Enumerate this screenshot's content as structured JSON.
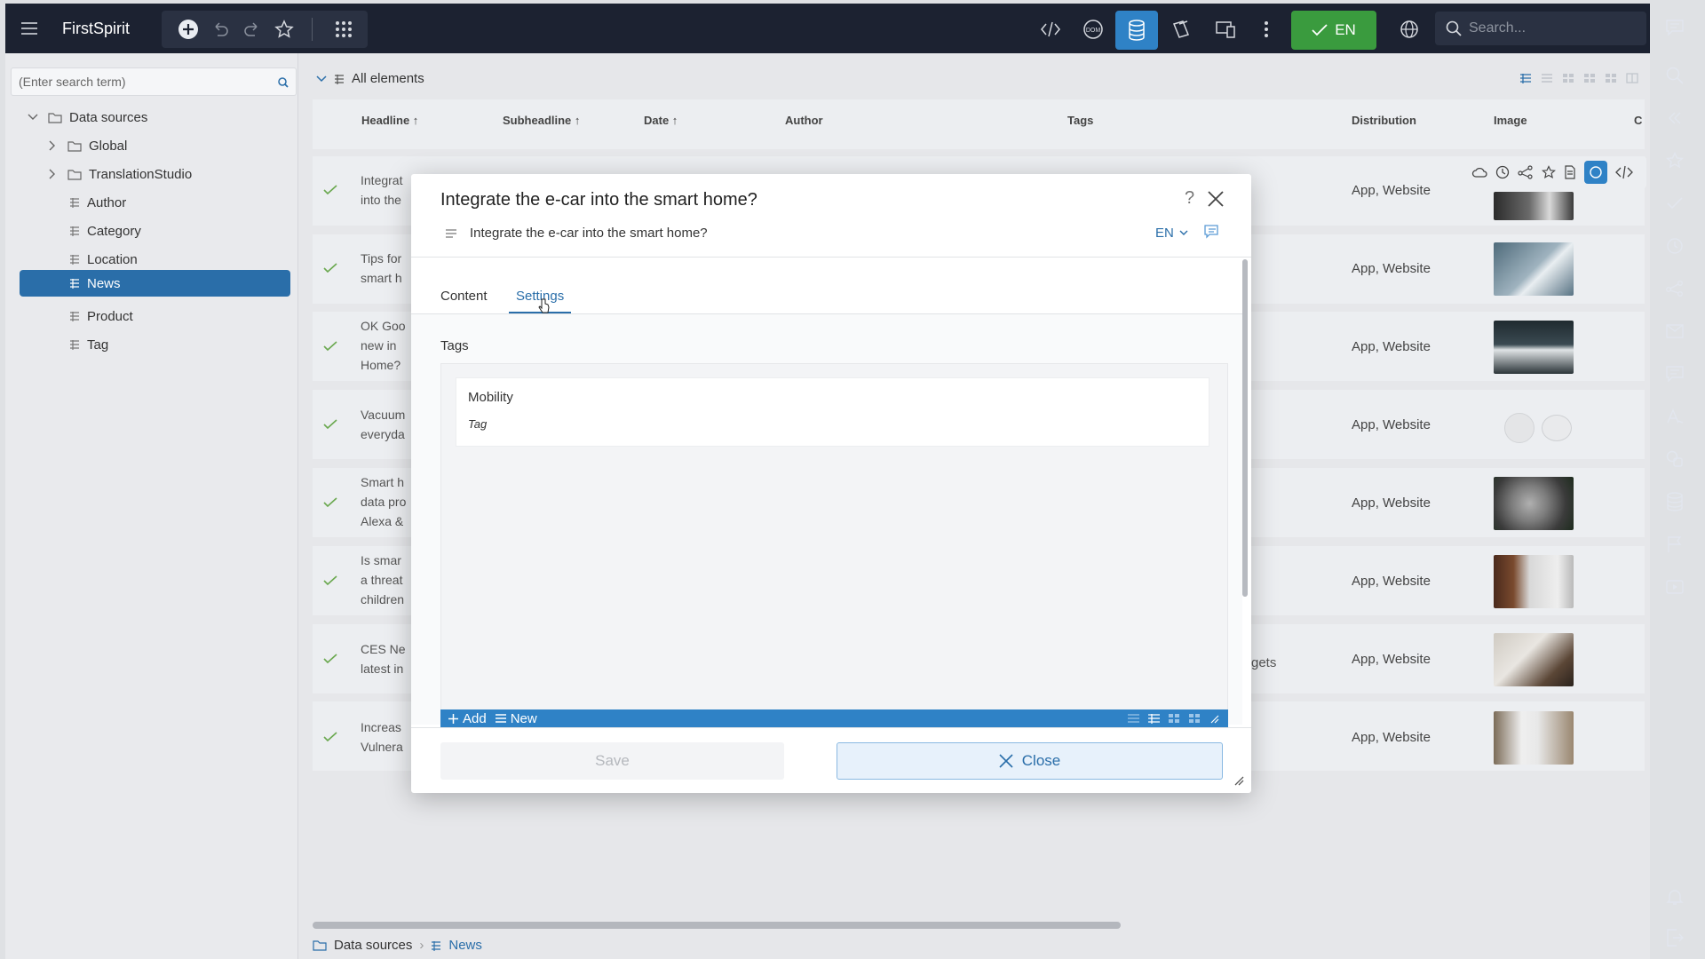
{
  "app": {
    "title": "FirstSpirit"
  },
  "topbar": {
    "lang_button": "EN",
    "search_placeholder": "Search..."
  },
  "tree": {
    "search_placeholder": "(Enter search term)",
    "root": "Data sources",
    "items": [
      {
        "label": "Global",
        "kind": "folder"
      },
      {
        "label": "TranslationStudio",
        "kind": "folder"
      },
      {
        "label": "Author",
        "kind": "table"
      },
      {
        "label": "Category",
        "kind": "table"
      },
      {
        "label": "Location",
        "kind": "table"
      },
      {
        "label": "News",
        "kind": "table",
        "active": true
      },
      {
        "label": "Product",
        "kind": "table"
      },
      {
        "label": "Tag",
        "kind": "table"
      }
    ]
  },
  "list": {
    "filter": "All elements",
    "columns": [
      "Headline",
      "Subheadline",
      "Date",
      "Author",
      "Tags",
      "Distribution",
      "Image",
      "C"
    ],
    "rows": [
      {
        "headline": [
          "Integrat",
          "into the"
        ],
        "distribution": "App, Website"
      },
      {
        "headline": [
          "Tips for",
          "smart h"
        ],
        "distribution": "App, Website"
      },
      {
        "headline": [
          "OK Goo",
          "new in",
          "Home?"
        ],
        "distribution": "App, Website"
      },
      {
        "headline": [
          "Vacuum",
          "everyda"
        ],
        "distribution": "App, Website"
      },
      {
        "headline": [
          "Smart h",
          "data pro",
          "Alexa &"
        ],
        "distribution": "App, Website"
      },
      {
        "headline": [
          "Is smar",
          "a threat",
          "children"
        ],
        "distribution": "App, Website"
      },
      {
        "headline": [
          "CES Ne",
          "latest in"
        ],
        "tags": "gets",
        "distribution": "App, Website"
      },
      {
        "headline": [
          "Increas",
          "Vulnera"
        ],
        "distribution": "App, Website"
      }
    ]
  },
  "breadcrumb": {
    "root": "Data sources",
    "current": "News"
  },
  "modal": {
    "title": "Integrate the e-car into the smart home?",
    "subtitle": "Integrate the e-car into the smart home?",
    "lang": "EN",
    "help": "?",
    "tabs": [
      "Content",
      "Settings"
    ],
    "active_tab": "Settings",
    "section_label": "Tags",
    "tag": {
      "name": "Mobility",
      "type": "Tag"
    },
    "toolbar": {
      "add": "Add",
      "new": "New"
    },
    "save": "Save",
    "close": "Close"
  },
  "colors": {
    "topbar": "#1c2231",
    "accent": "#2a6ea9",
    "green": "#3a9b3e"
  }
}
